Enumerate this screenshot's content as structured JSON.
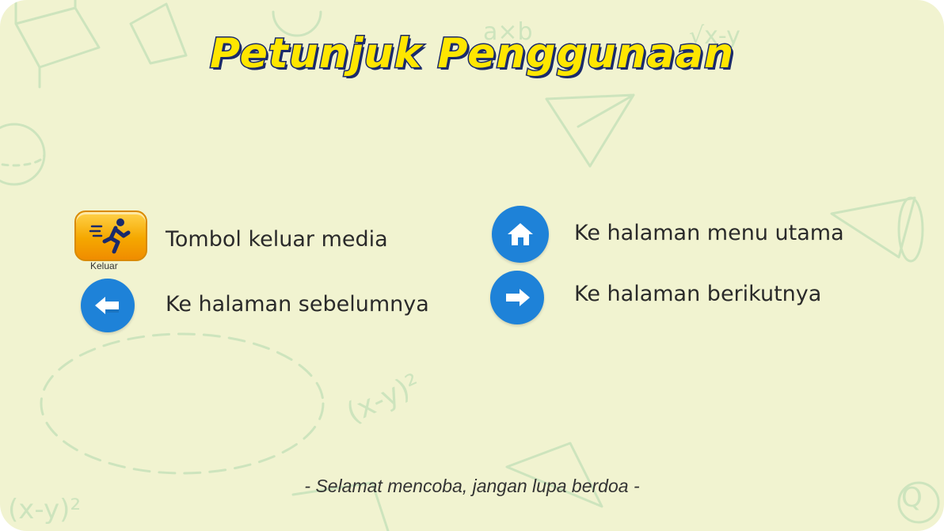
{
  "page": {
    "title": "Petunjuk Penggunaan",
    "footer": "- Selamat mencoba, jangan lupa berdoa -"
  },
  "help_items": [
    {
      "icon": "exit-running-icon",
      "caption": "Keluar",
      "label": "Tombol keluar media"
    },
    {
      "icon": "arrow-left-icon",
      "label": "Ke halaman sebelumnya"
    },
    {
      "icon": "home-icon",
      "label": "Ke halaman menu utama"
    },
    {
      "icon": "arrow-right-icon",
      "label": "Ke halaman berikutnya"
    }
  ],
  "background_doodles": [
    "a×b",
    "√x-y",
    "(x-y)²",
    "(x-y)²",
    "Q"
  ],
  "colors": {
    "background": "#f1f3d0",
    "title_fill": "#ffe600",
    "title_outline": "#1a2a6b",
    "button_blue": "#1e82d8",
    "exit_button": "#f5a800",
    "doodle": "#cfe5c0"
  }
}
